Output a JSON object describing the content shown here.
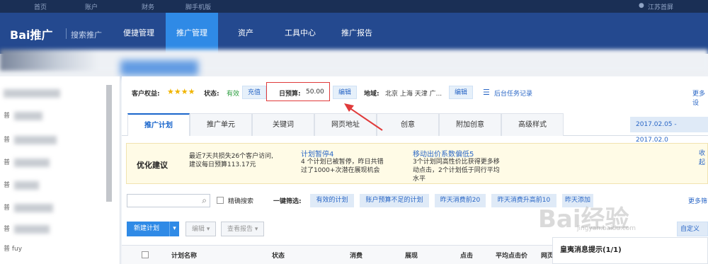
{
  "topbar": {
    "home": "首页",
    "account": "账户",
    "finance": "财务",
    "mobile": "脚手机版",
    "user": "江苏首屏"
  },
  "nav": {
    "logo": "Bai推广",
    "logo_sub": "搜索推广",
    "items": [
      "便捷管理",
      "推广管理",
      "资产",
      "工具中心",
      "推广报告"
    ]
  },
  "sidebar": {
    "rows": [
      "普",
      "普",
      "普",
      "普",
      "普",
      "普",
      "普 fuy"
    ]
  },
  "info": {
    "rights_label": "客户权益:",
    "status_label": "状态:",
    "status_value": "有效",
    "recharge": "充值",
    "budget_label": "日预算:",
    "budget_value": "50.00",
    "edit": "编辑",
    "region_label": "地域:",
    "region_value": "北京 上海 天津 广...",
    "edit2": "编辑",
    "task_log": "后台任务记录",
    "more": "更多设"
  },
  "tabs": [
    "推广计划",
    "推广单元",
    "关键词",
    "网页地址",
    "创意",
    "附加创意",
    "高级样式"
  ],
  "date_range": "2017.02.05 - 2017.02.0",
  "advice": {
    "title": "优化建议",
    "p1": "最近7天共损失26个客户访问,",
    "p1b": "建议每日预算113.17元",
    "l2": "计划暂停4",
    "p2": "4 个计划已被暂停，昨日共错",
    "p2b": "过了1000+次潜在展现机会",
    "l3": "移动出价系数偏低5",
    "p3": "3个计划同高性价比获得更多移",
    "p3b": "动点击，2个计划低于同行平均",
    "p3c": "水平",
    "collapse": "收起"
  },
  "filter": {
    "exact": "精确搜索",
    "quick": "一键筛选:",
    "chips": [
      "有效的计划",
      "账户预算不足的计划",
      "昨天消费前20",
      "昨天消费升高前10",
      "昨天添加"
    ],
    "more": "更多筛"
  },
  "actions": {
    "new": "新建计划",
    "edit": "编辑",
    "report": "查看报告",
    "custom": "自定义"
  },
  "table_headers": [
    "计划名称",
    "状态",
    "消费",
    "展现",
    "点击",
    "平均点击价",
    "网页"
  ],
  "popup": {
    "title": "皇夷消息提示(1/1)"
  },
  "watermark": {
    "main": "Bai经验",
    "sub": "jingyan.baidu.com"
  }
}
